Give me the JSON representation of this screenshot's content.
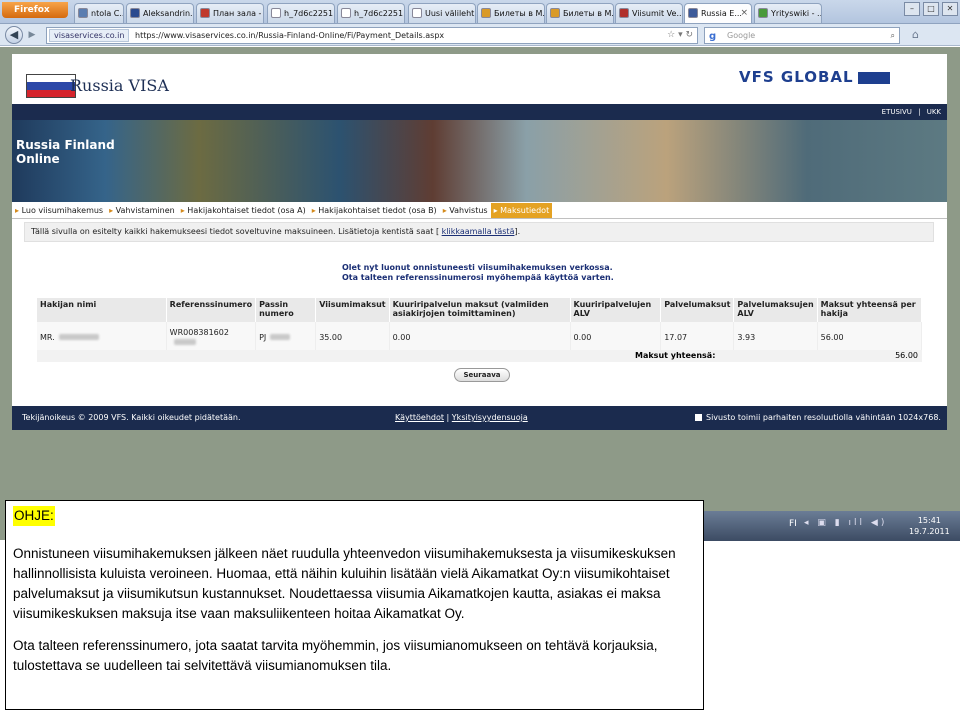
{
  "browser": {
    "menu_button": "Firefox",
    "tabs": [
      {
        "label": "ntola C...",
        "icon": "page-icon",
        "color": "#5a7db0"
      },
      {
        "label": "Aleksandrin...",
        "icon": "page-icon",
        "color": "#2b4a8e"
      },
      {
        "label": "План зала - ...",
        "icon": "page-icon",
        "color": "#c0392b"
      },
      {
        "label": "h_7d6c2251...",
        "icon": "page-icon",
        "color": "#ffffff"
      },
      {
        "label": "h_7d6c2251...",
        "icon": "page-icon",
        "color": "#ffffff"
      },
      {
        "label": "Uusi välilehti",
        "icon": "page-icon",
        "color": "#ffffff"
      },
      {
        "label": "Билеты в М...",
        "icon": "page-icon",
        "color": "#d99a27"
      },
      {
        "label": "Билеты в М...",
        "icon": "page-icon",
        "color": "#d99a27"
      },
      {
        "label": "Viisumit Ve...",
        "icon": "page-icon",
        "color": "#b0302b"
      },
      {
        "label": "Russia E...",
        "icon": "page-icon",
        "color": "#3c5a9a",
        "active": true
      },
      {
        "label": "Yrityswiki - ...",
        "icon": "page-icon",
        "color": "#4a9a3a"
      }
    ],
    "site_badge": "visaservices.co.in",
    "url": "https://www.visaservices.co.in/Russia-Finland-Online/Fi/Payment_Details.aspx",
    "search_placeholder": "Google"
  },
  "page": {
    "site_title": "Russia VISA",
    "vfs_logo": "VFS GLOBAL",
    "top_links": "ETUSIVU | UKK",
    "banner_title": [
      "Russia Finland",
      "Online"
    ],
    "breadcrumb": [
      {
        "label": "Luo viisumihakemus"
      },
      {
        "label": "Vahvistaminen"
      },
      {
        "label": "Hakijakohtaiset tiedot (osa A)"
      },
      {
        "label": "Hakijakohtaiset tiedot (osa B)"
      },
      {
        "label": "Vahvistus"
      },
      {
        "label": "Maksutiedot",
        "selected": true
      }
    ],
    "info_text": "Tällä sivulla on esitelty kaikki hakemukseesi tiedot soveltuvine maksuineen. Lisätietoja kentistä saat",
    "info_link": "klikkaamalla tästä",
    "notice_line1": "Olet nyt luonut onnistuneesti viisumihakemuksen verkossa.",
    "notice_line2": "Ota talteen referenssinumerosi myöhempää käyttöä varten.",
    "table": {
      "headers": [
        "Hakijan nimi",
        "Referenssinumero",
        "Passin numero",
        "Viisumimaksut",
        "Kuuriripalvelun maksut (valmiiden asiakirjojen toimittaminen)",
        "Kuuriripalvelujen ALV",
        "Palvelumaksut",
        "Palvelumaksujen ALV",
        "Maksut yhteensä per hakija"
      ],
      "row": [
        "MR.",
        "WR008381602",
        "PJ",
        "35.00",
        "0.00",
        "0.00",
        "17.07",
        "3.93",
        "56.00"
      ]
    },
    "total_label": "Maksut yhteensä:",
    "total_value": "56.00",
    "next_button": "Seuraava",
    "footer_copyright": "Tekijänoikeus © 2009 VFS. Kaikki oikeudet pidätetään.",
    "footer_links": [
      "Käyttöehdot",
      "Yksityisyydensuoja"
    ],
    "footer_note": "Sivusto toimii parhaiten resoluutiolla vähintään 1024x768."
  },
  "taskbar": {
    "lang": "FI",
    "time": "15:41",
    "date": "19.7.2011"
  },
  "help": {
    "title": "OHJE:",
    "paragraph1": "Onnistuneen viisumihakemuksen jälkeen näet ruudulla yhteenvedon viisumihakemuksesta ja viisumikeskuksen hallinnollisista kuluista veroineen. Huomaa, että näihin kuluihin lisätään vielä Aikamatkat Oy:n viisumikohtaiset palvelumaksut ja viisumikutsun kustannukset. Noudettaessa viisumia Aikamatkojen kautta, asiakas ei maksa viisumikeskuksen maksuja itse vaan maksuliikenteen hoitaa Aikamatkat Oy.",
    "paragraph2": "Ota talteen referenssinumero, jota saatat tarvita myöhemmin, jos viisumianomukseen on tehtävä korjauksia, tulostettava se uudelleen tai selvitettävä viisumianomuksen tila."
  }
}
